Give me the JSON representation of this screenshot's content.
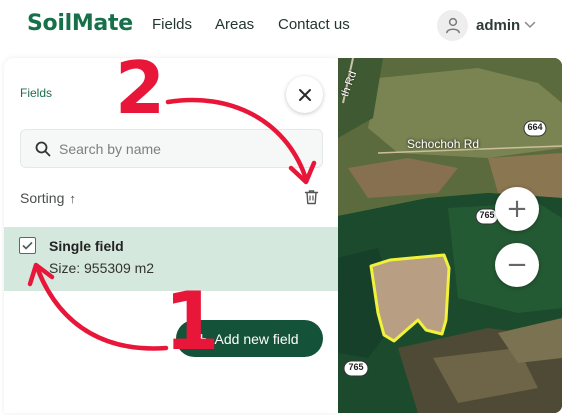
{
  "header": {
    "logo": "SoilMate",
    "nav": [
      "Fields",
      "Areas",
      "Contact us"
    ],
    "user": {
      "name": "admin",
      "avatar_icon": "user-icon",
      "chevron_icon": "chevron-down-icon"
    }
  },
  "panel": {
    "title": "Fields",
    "close_icon": "close-icon",
    "search": {
      "placeholder": "Search by name",
      "value": ""
    },
    "sorting_label": "Sorting",
    "sorting_arrow": "↑",
    "delete_icon": "trash-icon",
    "fields": [
      {
        "name": "Single field",
        "size": "Size: 955309 m2",
        "checked": true
      }
    ],
    "add_button": {
      "icon": "+",
      "label": "Add new field"
    }
  },
  "map": {
    "labels": {
      "road_top": "th Rd",
      "road_name": "Schochoh Rd",
      "route_664": "664",
      "route_765_top": "765",
      "route_765_bottom": "765"
    },
    "zoom_in": "+",
    "zoom_out": "−",
    "field_outline_color": "#f2f23a"
  },
  "annotations": {
    "step_1": "1",
    "step_2": "2",
    "color": "#e8173a"
  },
  "colors": {
    "brand": "#17704a",
    "button": "#15523a",
    "selected_row": "#d5e8de"
  }
}
